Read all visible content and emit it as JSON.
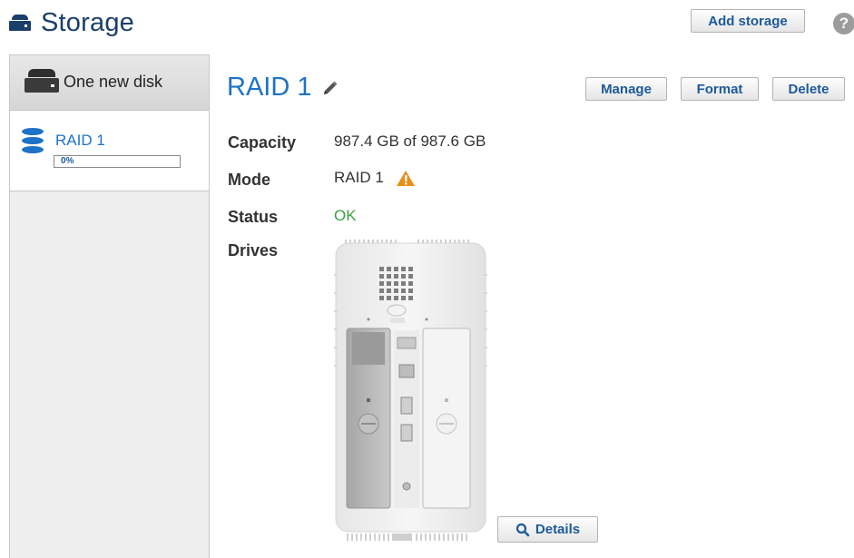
{
  "header": {
    "title": "Storage",
    "add_storage_label": "Add storage",
    "help_glyph": "?"
  },
  "sidebar": {
    "new_disk": {
      "label": "One new disk",
      "icon": "hard-drive-icon"
    },
    "raid_item": {
      "label": "RAID 1",
      "progress_text": "0%",
      "progress": 0,
      "icon": "database-icon"
    }
  },
  "detail": {
    "title": "RAID 1",
    "buttons": {
      "manage": "Manage",
      "format": "Format",
      "delete": "Delete"
    },
    "rows": {
      "capacity": {
        "label": "Capacity",
        "value": "987.4 GB of 987.6 GB"
      },
      "mode": {
        "label": "Mode",
        "value": "RAID 1"
      },
      "status": {
        "label": "Status",
        "value": "OK"
      },
      "drives": {
        "label": "Drives"
      }
    },
    "details_button": "Details"
  },
  "colors": {
    "accent": "#1e72c8",
    "title_dark": "#1a3f6b",
    "ok_green": "#3aa043",
    "warning_orange": "#e8901c"
  }
}
